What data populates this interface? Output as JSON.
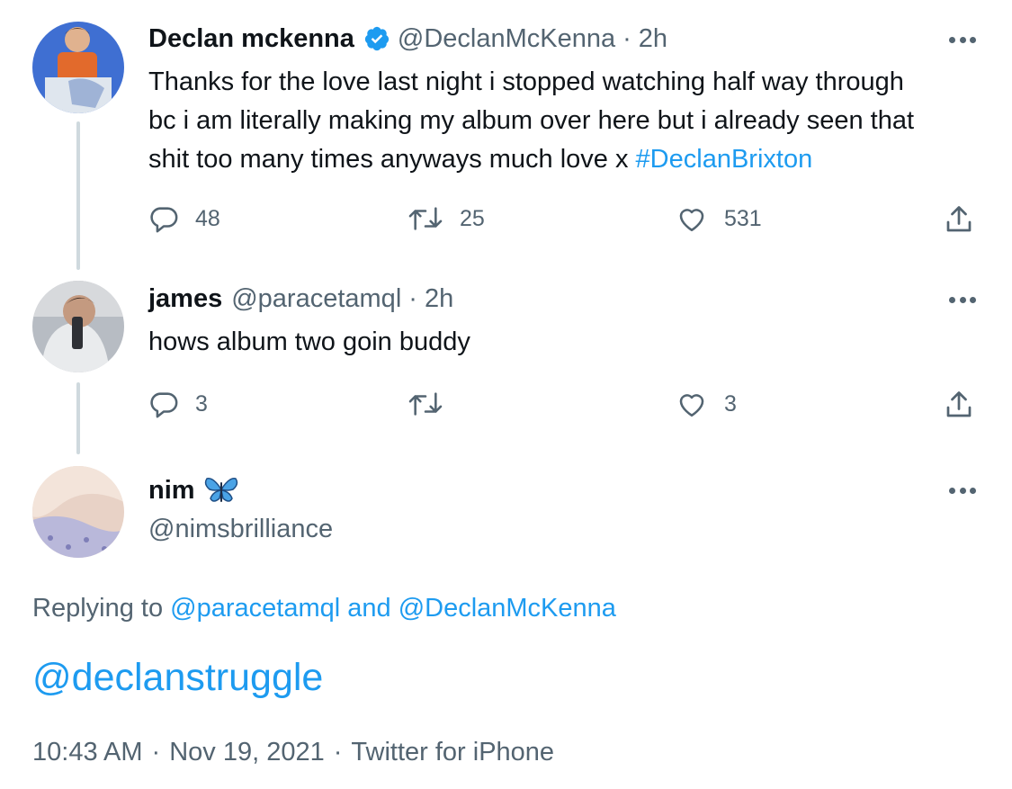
{
  "tweets": [
    {
      "name": "Declan mckenna",
      "verified": true,
      "handle": "@DeclanMcKenna",
      "separator": "·",
      "time": "2h",
      "text_line1": "Thanks for the love last night i stopped watching half way through",
      "text_line2": "bc i am literally making my album over here but i already seen that",
      "text_line3_plain": "shit too many times anyways much love x ",
      "hashtag": "#DeclanBrixton",
      "replies": "48",
      "retweets": "25",
      "likes": "531"
    },
    {
      "name": "james",
      "handle": "@paracetamql",
      "separator": "·",
      "time": "2h",
      "text": "hows album two goin buddy",
      "replies": "3",
      "retweets": "",
      "likes": "3"
    }
  ],
  "focused": {
    "name": "nim",
    "emoji": "butterfly-icon",
    "handle": "@nimsbrilliance",
    "replying_prefix": "Replying to ",
    "reply_mention_1": "@paracetamql",
    "replying_and": " and ",
    "reply_mention_2": "@DeclanMcKenna",
    "text": "@declanstruggle",
    "time": "10:43 AM",
    "date": "Nov 19, 2021",
    "source": "Twitter for iPhone",
    "separator": "·"
  },
  "colors": {
    "accent": "#1d9bf0",
    "secondary_text": "#536471",
    "thread_line": "#cfd9de"
  }
}
